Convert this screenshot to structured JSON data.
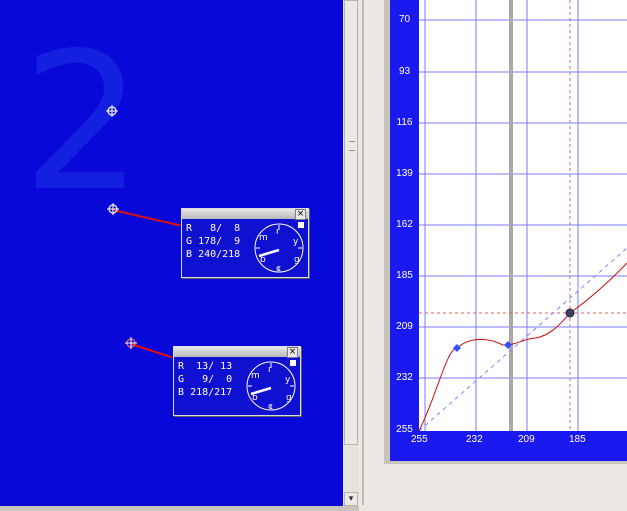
{
  "canvas": {
    "background": "#0808d8",
    "numeral": "2"
  },
  "readouts": [
    {
      "r_label": "R",
      "r_values": "  8/  8",
      "g_label": "G",
      "g_values": "178/  9",
      "b_label": "B",
      "b_values": "240/218",
      "close_label": "×"
    },
    {
      "r_label": "R",
      "r_values": " 13/ 13",
      "g_label": "G",
      "g_values": "  9/  0",
      "b_label": "B",
      "b_values": "218/217",
      "close_label": "×"
    }
  ],
  "dial_letters": [
    "m",
    "r",
    "y",
    "g",
    "c",
    "b"
  ],
  "scrollbar": {
    "down_arrow": "▾"
  },
  "curve_chart": {
    "y_ticks": [
      "70",
      "93",
      "116",
      "139",
      "162",
      "185",
      "209",
      "232",
      "255"
    ],
    "x_ticks": [
      "255",
      "232",
      "209",
      "185"
    ],
    "colors": {
      "axis": "#1a1af0",
      "grid": "#7a7aff",
      "curve": "#cc1010",
      "guide": "#8080ff"
    }
  }
}
